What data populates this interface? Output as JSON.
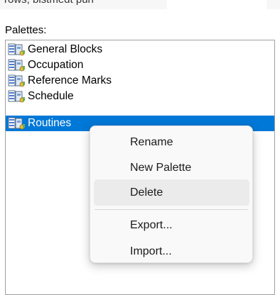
{
  "header": {
    "partial_text": "rows, bistmedt pun"
  },
  "palettes": {
    "label": "Palettes:",
    "items": [
      {
        "label": "General Blocks",
        "icon": "palette-icon",
        "selected": false
      },
      {
        "label": "Occupation",
        "icon": "palette-icon",
        "selected": false
      },
      {
        "label": "Reference Marks",
        "icon": "palette-icon",
        "selected": false
      },
      {
        "label": "Schedule",
        "icon": "palette-icon",
        "selected": false
      },
      {
        "label": "Routines",
        "icon": "palette-icon",
        "selected": true
      }
    ]
  },
  "context_menu": {
    "items": [
      {
        "label": "Rename"
      },
      {
        "label": "New Palette"
      },
      {
        "label": "Delete",
        "state": "hover"
      },
      {
        "label": "Export..."
      },
      {
        "label": "Import..."
      }
    ]
  },
  "colors": {
    "selection": "#0078d7",
    "menu_background": "#f9f9f9",
    "menu_hover": "#ebebeb"
  }
}
